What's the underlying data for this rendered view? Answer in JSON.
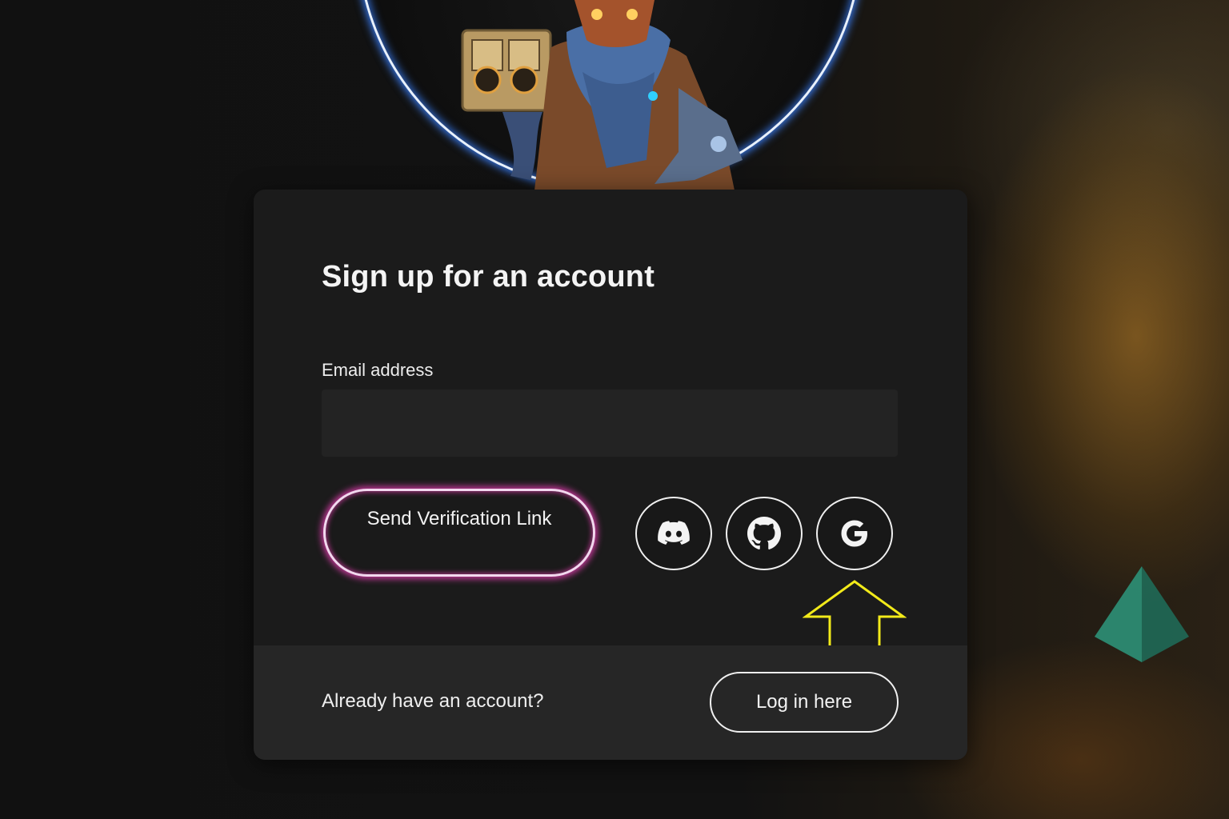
{
  "form": {
    "title": "Sign up for an account",
    "email_label": "Email address",
    "email_value": "",
    "email_placeholder": "",
    "send_button_label": "Send Verification Link"
  },
  "oauth": [
    {
      "provider": "discord",
      "icon": "discord-icon"
    },
    {
      "provider": "github",
      "icon": "github-icon"
    },
    {
      "provider": "google",
      "icon": "google-icon"
    }
  ],
  "footer": {
    "prompt_text": "Already have an account?",
    "login_button_label": "Log in here"
  },
  "annotation": {
    "arrow_color": "#f2ea1a",
    "points_to": "google"
  },
  "colors": {
    "portrait_ring_glow": "#3c82ff",
    "send_button_glow": "#dc3caa",
    "card_background": "#1b1b1b",
    "footer_background": "#262626"
  }
}
